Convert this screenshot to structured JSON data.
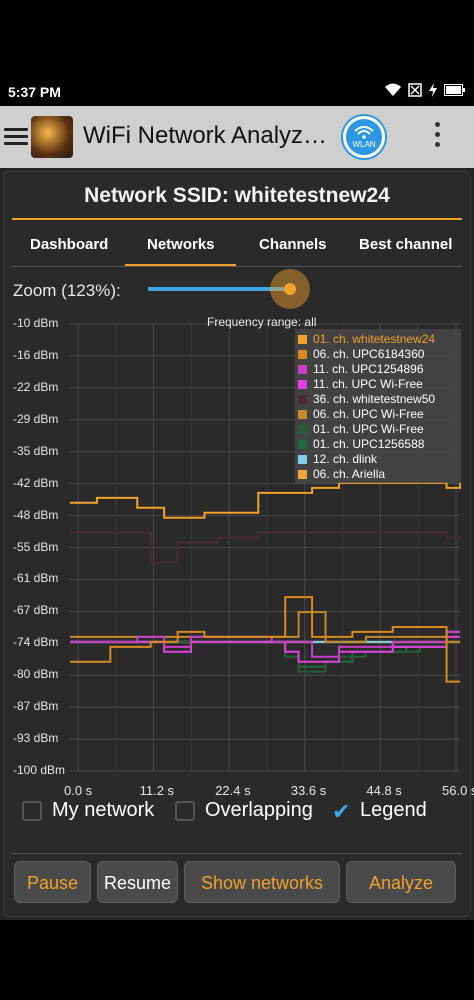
{
  "status_bar": {
    "time": "5:37 PM"
  },
  "app_bar": {
    "title": "WiFi Network Analyz…",
    "wlan_label": "WLAN"
  },
  "header": {
    "ssid_title": "Network SSID: whitetestnew24"
  },
  "tabs": [
    {
      "label": "Dashboard"
    },
    {
      "label": "Networks",
      "selected": true
    },
    {
      "label": "Channels"
    },
    {
      "label": "Best channel"
    }
  ],
  "zoom": {
    "label": "Zoom (123%):",
    "level_percent": 123
  },
  "chart_data": {
    "type": "line",
    "title": "Frequency range: all",
    "y_ticks": [
      "-10 dBm",
      "-16 dBm",
      "-22 dBm",
      "-29 dBm",
      "-35 dBm",
      "-42 dBm",
      "-48 dBm",
      "-55 dBm",
      "-61 dBm",
      "-67 dBm",
      "-74 dBm",
      "-80 dBm",
      "-87 dBm",
      "-93 dBm",
      "-100 dBm"
    ],
    "x_ticks": [
      "0.0 s",
      "11.2 s",
      "22.4 s",
      "33.6 s",
      "44.8 s",
      "56.0 s"
    ],
    "x": [
      0,
      2,
      4,
      6,
      8,
      10,
      12,
      14,
      16,
      18,
      20,
      22,
      24,
      26,
      28,
      30,
      32,
      34,
      36,
      38,
      40,
      42,
      44,
      46,
      48,
      50,
      52,
      54,
      56,
      58
    ],
    "ylim": [
      -100,
      -10
    ],
    "xlim": [
      0,
      58
    ],
    "grid": true,
    "legend_position": "top-right",
    "series": [
      {
        "name": "01. ch. whitetestnew24",
        "color": "#f2a12a",
        "values": [
          -46,
          -46,
          -45,
          -45,
          -45,
          -47,
          -47,
          -49,
          -49,
          -49,
          -48,
          -48,
          -48,
          -48,
          -44,
          -44,
          -44,
          -44,
          -43,
          -43,
          -42,
          -42,
          -42,
          -42,
          -42,
          -42,
          -42,
          -42,
          -43,
          -42
        ]
      },
      {
        "name": "06. ch. UPC6184360",
        "color": "#d98a1e",
        "values": [
          -78,
          -78,
          -78,
          -75,
          -75,
          -75,
          -74,
          -74,
          -72,
          -72,
          -73,
          -73,
          -73,
          -73,
          -73,
          -73,
          -65,
          -65,
          -73,
          -73,
          -73,
          -72,
          -72,
          -72,
          -71,
          -71,
          -71,
          -71,
          -82,
          -82
        ]
      },
      {
        "name": "11. ch. UPC1254896",
        "color": "#c83ec8",
        "values": [
          -74,
          -74,
          -74,
          -74,
          -74,
          -73,
          -73,
          -75,
          -75,
          -73,
          -73,
          -73,
          -73,
          -73,
          -73,
          -74,
          -74,
          -74,
          -77,
          -77,
          -75,
          -75,
          -75,
          -75,
          -74,
          -74,
          -74,
          -74,
          -72,
          -72
        ]
      },
      {
        "name": "11. ch. UPC Wi-Free",
        "color": "#e040e0",
        "values": [
          -74,
          -74,
          -74,
          -74,
          -74,
          -74,
          -74,
          -76,
          -76,
          -74,
          -74,
          -74,
          -74,
          -74,
          -74,
          -74,
          -76,
          -78,
          -78,
          -78,
          -76,
          -76,
          -76,
          -76,
          -75,
          -75,
          -75,
          -75,
          -73,
          -73
        ]
      },
      {
        "name": "36. ch. whitetestnew50",
        "color": "#4a2a30",
        "values": [
          -52,
          -52,
          -52,
          -52,
          -52,
          -52,
          -58,
          -58,
          -54,
          -54,
          -54,
          -53,
          -53,
          -53,
          -52,
          -52,
          -52,
          -52,
          -52,
          -52,
          -52,
          -52,
          -52,
          -52,
          -52,
          -52,
          -52,
          -52,
          -53,
          -53
        ]
      },
      {
        "name": "06. ch. UPC Wi-Free",
        "color": "#c48a2a",
        "values": [
          -73,
          -73,
          -73,
          -73,
          -73,
          -73,
          -73,
          -73,
          -73,
          -73,
          -73,
          -73,
          -73,
          -73,
          -73,
          -73,
          -73,
          -68,
          -68,
          -74,
          -74,
          -74,
          -73,
          -73,
          -73,
          -73,
          -73,
          -73,
          -74,
          -74
        ]
      },
      {
        "name": "01. ch. UPC Wi-Free",
        "color": "#2a5a3a",
        "values": [
          -74,
          -74,
          -74,
          -74,
          -74,
          -74,
          -74,
          -74,
          -74,
          -74,
          -74,
          -74,
          -74,
          -74,
          -74,
          -74,
          -77,
          -80,
          -80,
          -78,
          -77,
          -77,
          -76,
          -76,
          -76,
          -76,
          -75,
          -75,
          -74,
          -74
        ]
      },
      {
        "name": "01. ch. UPC1256588",
        "color": "#1f6b40",
        "values": [
          -74,
          -74,
          -74,
          -74,
          -74,
          -74,
          -74,
          -74,
          -74,
          -74,
          -74,
          -74,
          -74,
          -74,
          -74,
          -74,
          -77,
          -79,
          -79,
          -78,
          -78,
          -76,
          -76,
          -76,
          -76,
          -75,
          -75,
          -75,
          -74,
          -74
        ]
      },
      {
        "name": "12. ch. dlink",
        "color": "#7fd0e8",
        "values": [
          -74,
          -74,
          -74,
          -74,
          -74,
          -74,
          -74,
          -74,
          -74,
          -74,
          -74,
          -74,
          -74,
          -74,
          -74,
          -74,
          -74,
          -74,
          -74,
          -74,
          -74,
          -74,
          -74,
          -74,
          -75,
          -75,
          -75,
          -75,
          -72,
          -72
        ]
      },
      {
        "name": "06. ch. Ariella",
        "color": "#f0a43a",
        "values": [
          -74,
          -74,
          -74,
          -74,
          -74,
          -74,
          -74,
          -74,
          -74,
          -74,
          -74,
          -74,
          -74,
          -74,
          -74,
          -74,
          -74,
          -74,
          -74,
          -74,
          -74,
          -74,
          -74,
          -74,
          -74,
          -74,
          -74,
          -74,
          -74,
          -74
        ]
      }
    ]
  },
  "options": [
    {
      "label": "My network",
      "checked": false
    },
    {
      "label": "Overlapping",
      "checked": false
    },
    {
      "label": "Legend",
      "checked": true
    }
  ],
  "buttons": {
    "pause": "Pause",
    "resume": "Resume",
    "show_networks": "Show networks",
    "analyze": "Analyze"
  },
  "colors": {
    "accent": "#f2a12a",
    "slider": "#3fa7e6",
    "background": "#2a2a2a"
  }
}
